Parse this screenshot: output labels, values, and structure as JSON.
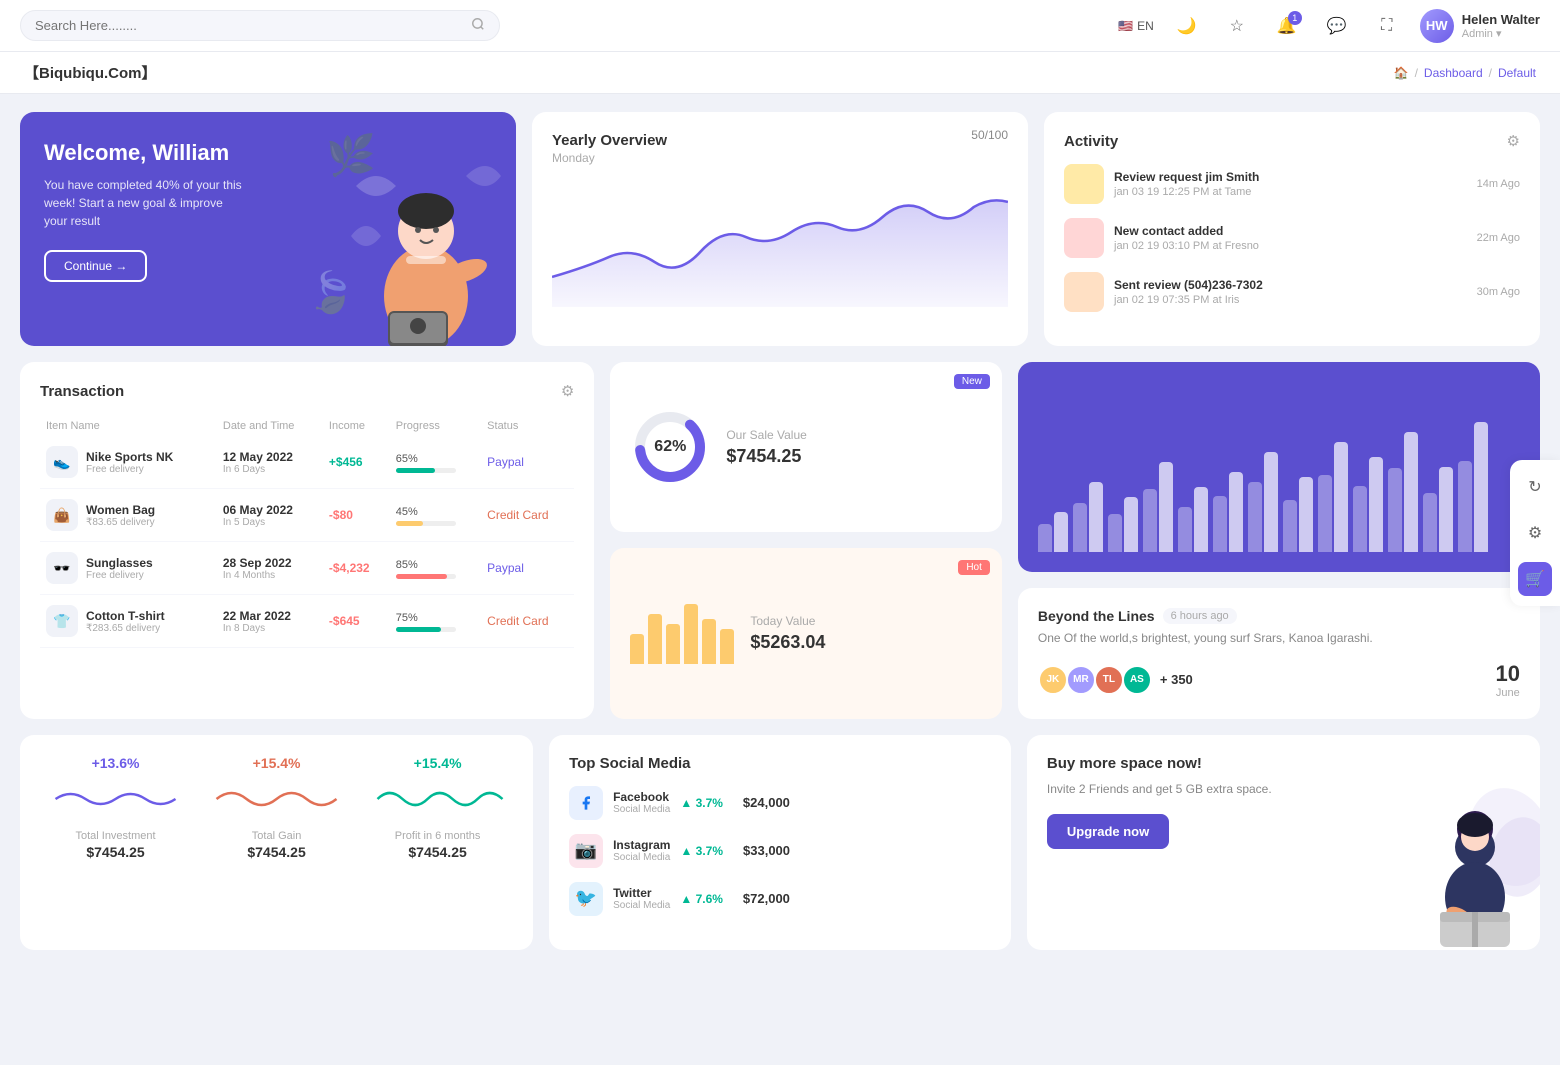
{
  "topnav": {
    "search_placeholder": "Search Here........",
    "lang": "EN",
    "bell_badge": "1",
    "user": {
      "name": "Helen Walter",
      "role": "Admin",
      "initials": "HW"
    }
  },
  "breadcrumb": {
    "brand": "【Biqubiqu.Com】",
    "home": "🏠",
    "sep1": "/",
    "page1": "Dashboard",
    "sep2": "/",
    "page2": "Default"
  },
  "welcome": {
    "title": "Welcome, William",
    "subtitle": "You have completed 40% of your this week! Start a new goal & improve your result",
    "btn": "Continue →"
  },
  "yearly": {
    "title": "Yearly Overview",
    "day": "Monday",
    "badge": "50/100"
  },
  "activity": {
    "title": "Activity",
    "items": [
      {
        "title": "Review request jim Smith",
        "sub": "jan 03 19 12:25 PM at Tame",
        "time": "14m Ago",
        "color": "peach"
      },
      {
        "title": "New contact added",
        "sub": "jan 02 19 03:10 PM at Fresno",
        "time": "22m Ago",
        "color": "pink"
      },
      {
        "title": "Sent review (504)236-7302",
        "sub": "jan 02 19 07:35 PM at Iris",
        "time": "30m Ago",
        "color": "orange"
      }
    ]
  },
  "transaction": {
    "title": "Transaction",
    "headers": [
      "Item Name",
      "Date and Time",
      "Income",
      "Progress",
      "Status"
    ],
    "rows": [
      {
        "name": "Nike Sports NK",
        "sub": "Free delivery",
        "icon": "👟",
        "date": "12 May 2022",
        "date_sub": "In 6 Days",
        "income": "+$456",
        "income_type": "pos",
        "progress": 65,
        "progress_color": "green",
        "status": "Paypal",
        "status_type": "paypal"
      },
      {
        "name": "Women Bag",
        "sub": "₹83.65 delivery",
        "icon": "👜",
        "date": "06 May 2022",
        "date_sub": "In 5 Days",
        "income": "-$80",
        "income_type": "neg",
        "progress": 45,
        "progress_color": "orange",
        "status": "Credit Card",
        "status_type": "credit"
      },
      {
        "name": "Sunglasses",
        "sub": "Free delivery",
        "icon": "🕶️",
        "date": "28 Sep 2022",
        "date_sub": "In 4 Months",
        "income": "-$4,232",
        "income_type": "neg",
        "progress": 85,
        "progress_color": "red",
        "status": "Paypal",
        "status_type": "paypal"
      },
      {
        "name": "Cotton T-shirt",
        "sub": "₹283.65 delivery",
        "icon": "👕",
        "date": "22 Mar 2022",
        "date_sub": "In 8 Days",
        "income": "-$645",
        "income_type": "neg",
        "progress": 75,
        "progress_color": "green",
        "status": "Credit Card",
        "status_type": "credit"
      }
    ]
  },
  "sale_value": {
    "badge": "New",
    "donut_pct": "62%",
    "label": "Our Sale Value",
    "value": "$7454.25"
  },
  "today_value": {
    "badge": "Hot",
    "label": "Today Value",
    "value": "$5263.04",
    "bars": [
      30,
      50,
      40,
      60,
      45,
      35
    ]
  },
  "bar_chart": {
    "bars": [
      40,
      70,
      55,
      90,
      65,
      80,
      100,
      75,
      110,
      95,
      120,
      85,
      130
    ]
  },
  "beyond": {
    "title": "Beyond the Lines",
    "time": "6 hours ago",
    "desc": "One Of the world,s brightest, young surf Srars, Kanoa Igarashi.",
    "plus_count": "+ 350",
    "date_num": "10",
    "date_month": "June",
    "avatars": [
      "JK",
      "MR",
      "TL",
      "AS"
    ]
  },
  "mini_stats": [
    {
      "pct": "+13.6%",
      "color": "purple",
      "label": "Total Investment",
      "value": "$7454.25"
    },
    {
      "pct": "+15.4%",
      "color": "orange",
      "label": "Total Gain",
      "value": "$7454.25"
    },
    {
      "pct": "+15.4%",
      "color": "green",
      "label": "Profit in 6 months",
      "value": "$7454.25"
    }
  ],
  "social": {
    "title": "Top Social Media",
    "items": [
      {
        "name": "Facebook",
        "sub": "Social Media",
        "icon": "f",
        "type": "fb",
        "pct": "3.7%",
        "amount": "$24,000"
      },
      {
        "name": "Instagram",
        "sub": "Social Media",
        "icon": "📷",
        "type": "ig",
        "pct": "3.7%",
        "amount": "$33,000"
      },
      {
        "name": "Twitter",
        "sub": "Social Media",
        "icon": "🐦",
        "type": "tw",
        "pct": "7.6%",
        "amount": "$72,000"
      }
    ]
  },
  "buy_space": {
    "title": "Buy more space now!",
    "desc": "Invite 2 Friends and get 5 GB extra space.",
    "btn": "Upgrade now"
  }
}
